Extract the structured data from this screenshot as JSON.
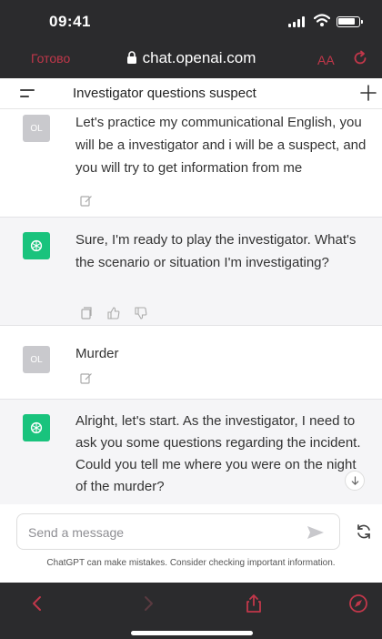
{
  "status_bar": {
    "time": "09:41"
  },
  "browser": {
    "done_label": "Готово",
    "url": "chat.openai.com",
    "text_size_label": "AA"
  },
  "chat": {
    "title": "Investigator questions suspect",
    "messages": [
      {
        "role": "user",
        "avatar": "OL",
        "text": "Let's practice my communicational English, you will be a investigator and i will be a suspect, and you will try to get information from me"
      },
      {
        "role": "assistant",
        "avatar_icon": "openai-logo-icon",
        "text": "Sure, I'm ready to play the investigator. What's the scenario or situation I'm investigating?"
      },
      {
        "role": "user",
        "avatar": "OL",
        "text": "Murder"
      },
      {
        "role": "assistant",
        "avatar_icon": "openai-logo-icon",
        "text": "Alright, let's start. As the investigator, I need to ask you some questions regarding the incident. Could you tell me where you were on the night of the murder?"
      }
    ]
  },
  "composer": {
    "placeholder": "Send a message",
    "disclaimer": "ChatGPT can make mistakes. Consider checking important information."
  },
  "colors": {
    "chrome_bg": "#2b2b2d",
    "accent_red": "#c1374a",
    "bot_avatar": "#19c37d",
    "user_avatar": "#c9c9cd"
  }
}
